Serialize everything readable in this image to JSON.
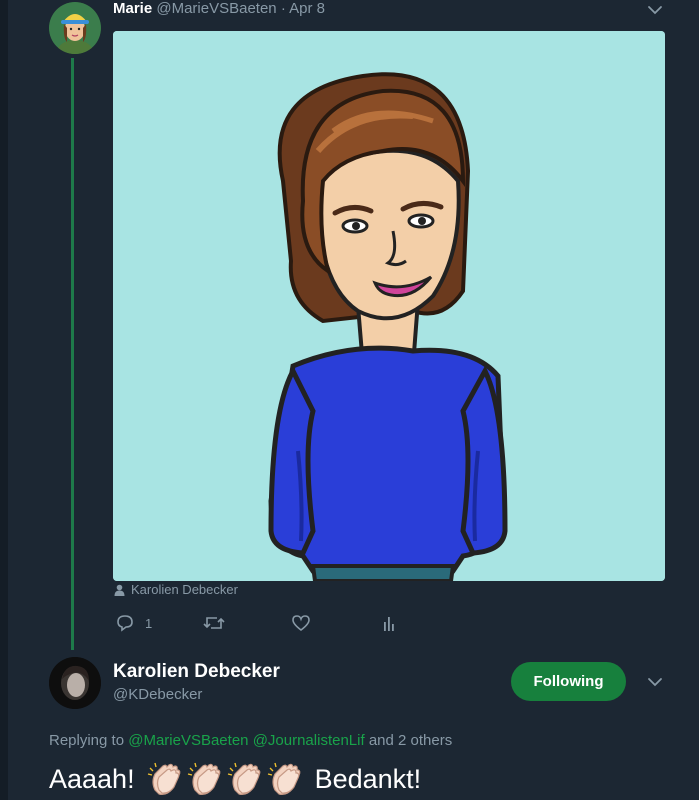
{
  "colors": {
    "background": "#1c2733",
    "thread_line": "#1e7a4a",
    "following_button": "#17803d",
    "mention": "#19a34a",
    "muted_text": "#8899a6",
    "media_background": "#a8e4e3"
  },
  "tweet": {
    "author_name": "Marie",
    "handle": "@MarieVSBaeten",
    "separator": " · ",
    "date": "Apr 8",
    "avatar_icon": "cartoon-avatar-icon",
    "media": {
      "description_icon": "cartoon-portrait-illustration",
      "tagged_icon": "person-icon",
      "tagged_user": "Karolien Debecker"
    },
    "actions": {
      "reply_icon": "reply-icon",
      "reply_count": "1",
      "retweet_icon": "retweet-icon",
      "like_icon": "heart-icon",
      "analytics_icon": "analytics-icon"
    }
  },
  "reply": {
    "author_name": "Karolien Debecker",
    "handle": "@KDebecker",
    "follow_label": "Following",
    "replying_prefix": "Replying to",
    "mention_1": "@MarieVSBaeten",
    "mention_2": "@JournalistenLif",
    "replying_suffix": "and 2 others",
    "text_start": "Aaaah!",
    "text_end": "Bedankt!",
    "emoji_icon": "clapping-hands-icon",
    "emoji_count": 4
  }
}
